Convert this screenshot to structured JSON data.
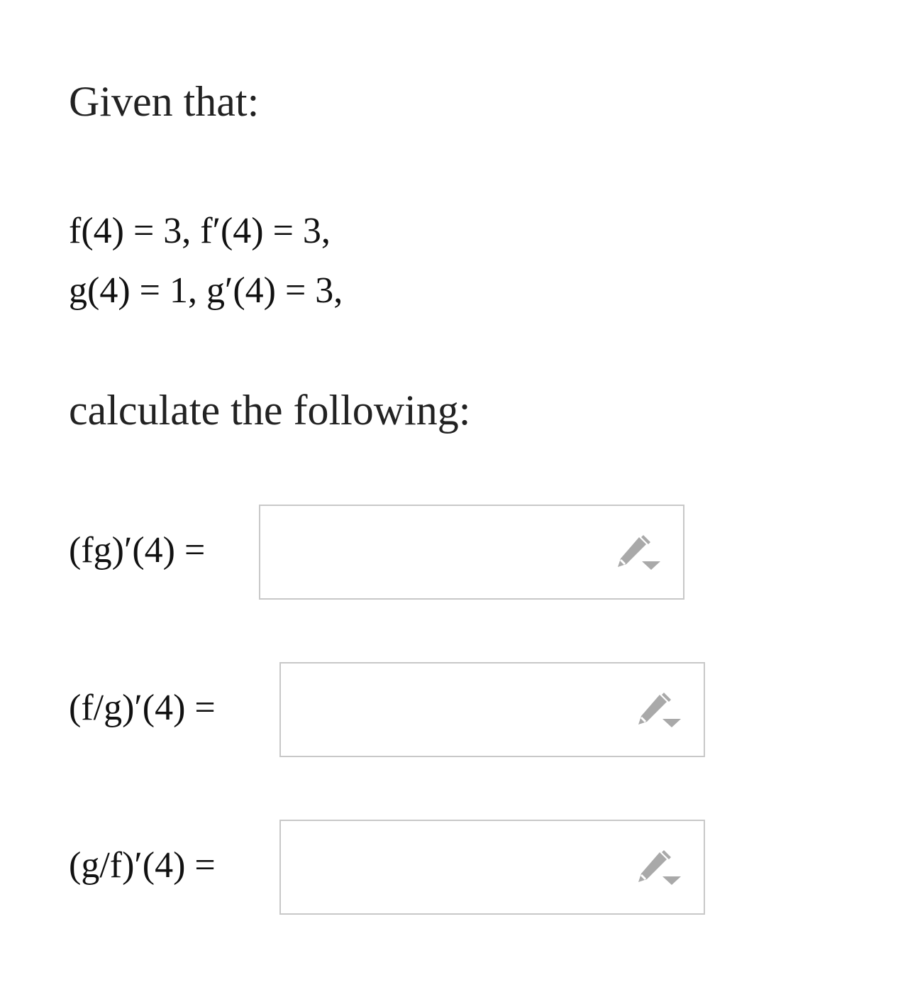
{
  "intro_text": "Given that:",
  "given": [
    "f(4) = 3,  f′(4) = 3,",
    "g(4) = 1,  g′(4) = 3,"
  ],
  "instruction_text": "calculate the following:",
  "questions": [
    {
      "label": "(fg)′(4) =",
      "value": "",
      "edit_icon": "pencil-dropdown-icon"
    },
    {
      "label": "(f/g)′(4) =",
      "value": "",
      "edit_icon": "pencil-dropdown-icon"
    },
    {
      "label": "(g/f)′(4) =",
      "value": "",
      "edit_icon": "pencil-dropdown-icon"
    }
  ],
  "colors": {
    "text": "#222222",
    "box_border": "#c8c8c8",
    "icon": "#a9a9a9"
  }
}
